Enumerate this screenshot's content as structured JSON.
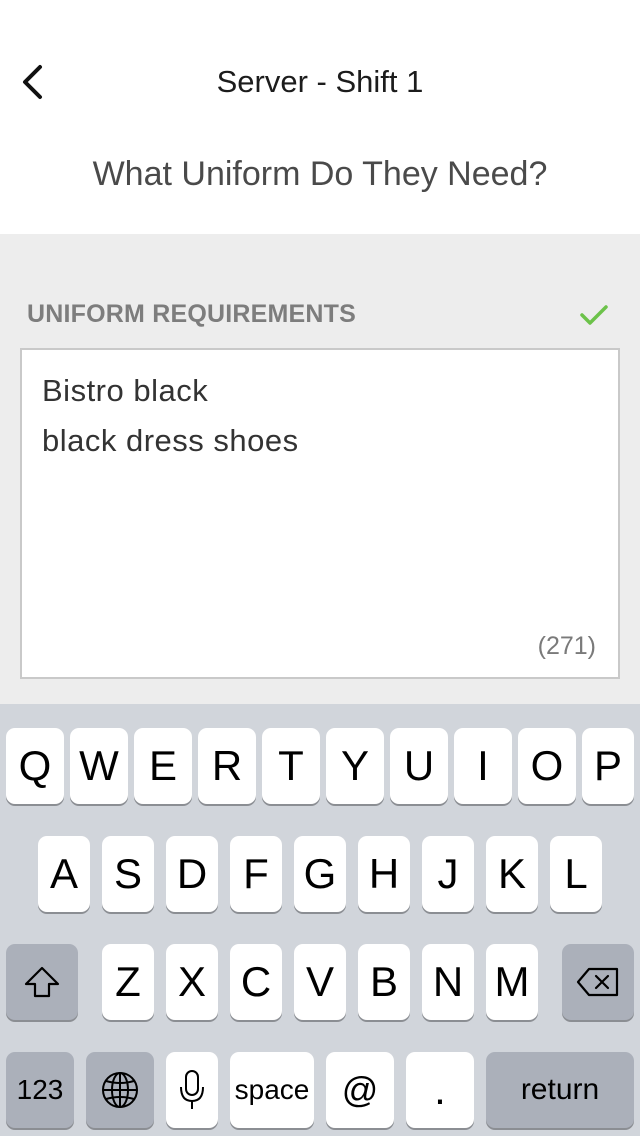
{
  "nav": {
    "title": "Server - Shift 1",
    "back_icon": "chevron-left-icon"
  },
  "question": "What Uniform Do They Need?",
  "form": {
    "label": "UNIFORM REQUIREMENTS",
    "valid_icon": "checkmark-icon",
    "valid_color": "#6cc24a",
    "lines": [
      "Bistro black",
      "black dress shoes"
    ],
    "char_count": "(271)"
  },
  "keyboard": {
    "row1": [
      "Q",
      "W",
      "E",
      "R",
      "T",
      "Y",
      "U",
      "I",
      "O",
      "P"
    ],
    "row2": [
      "A",
      "S",
      "D",
      "F",
      "G",
      "H",
      "J",
      "K",
      "L"
    ],
    "row3": [
      "Z",
      "X",
      "C",
      "V",
      "B",
      "N",
      "M"
    ],
    "shift_icon": "shift-icon",
    "delete_icon": "backspace-icon",
    "numbers_label": "123",
    "globe_icon": "globe-icon",
    "mic_icon": "microphone-icon",
    "space_label": "space",
    "at_label": "@",
    "period_label": ".",
    "return_label": "return"
  }
}
